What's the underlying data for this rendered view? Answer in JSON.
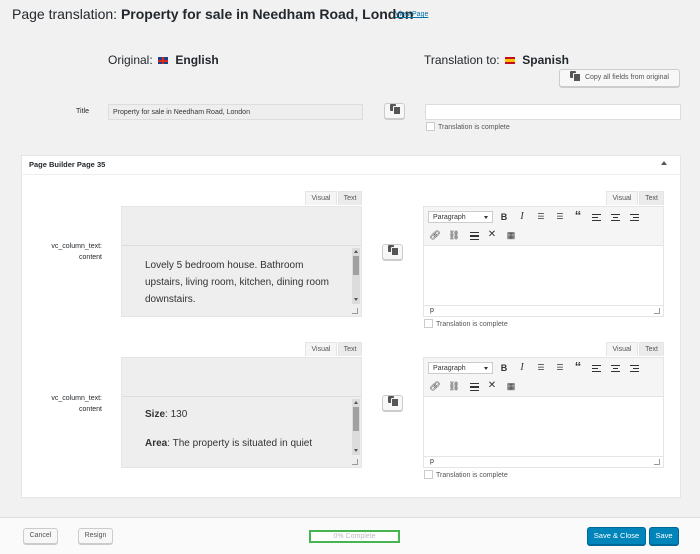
{
  "header": {
    "title_prefix": "Page translation: ",
    "title_name": "Property for sale in Needham Road, London",
    "view_link": "View Page"
  },
  "languages": {
    "original_label": "Original:",
    "original_lang": "English",
    "translation_label": "Translation to:",
    "translation_lang": "Spanish",
    "copy_all_label": "Copy all fields from original"
  },
  "title_field": {
    "label": "Title",
    "original_value": "Property for sale in Needham Road, London",
    "translation_value": "",
    "complete_label": "Translation is complete"
  },
  "panel": {
    "title": "Page Builder Page 35"
  },
  "fields": [
    {
      "label_line1": "vc_column_text:",
      "label_line2": "content",
      "tab_visual": "Visual",
      "tab_text": "Text",
      "original_text": "Lovely 5 bedroom house. Bathroom upstairs, living room, kitchen, dining room downstairs.",
      "format_value": "Paragraph",
      "status_path": "p",
      "complete_label": "Translation is complete"
    },
    {
      "label_line1": "vc_column_text:",
      "label_line2": "content",
      "tab_visual": "Visual",
      "tab_text": "Text",
      "original_line1_bold": "Size",
      "original_line1_rest": ": 130",
      "original_line2_bold": "Area",
      "original_line2_rest": ": The property is situated in quiet",
      "format_value": "Paragraph",
      "status_path": "p",
      "complete_label": "Translation is complete"
    }
  ],
  "footer": {
    "cancel_label": "Cancel",
    "resign_label": "Resign",
    "progress_label": "0% Complete",
    "progress_value": 0,
    "save_close_label": "Save & Close",
    "save_label": "Save"
  },
  "colors": {
    "primary": "#0085ba",
    "link": "#0073aa",
    "progress_border": "#46b450"
  }
}
